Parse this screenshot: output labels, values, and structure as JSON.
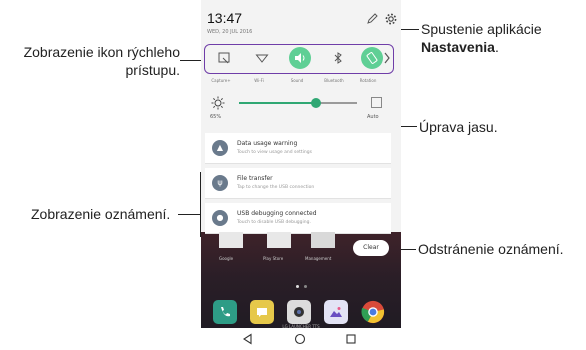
{
  "callouts": {
    "quick_access": "Zobrazenie ikon rýchleho prístupu.",
    "settings_prefix": "Spustenie aplikácie",
    "settings_bold": "Nastavenia",
    "settings_suffix": ".",
    "brightness": "Úprava jasu.",
    "notifications": "Zobrazenie oznámení.",
    "clear": "Odstránenie oznámení."
  },
  "status": {
    "time": "13:47",
    "date": "WED, 20 JUL 2016"
  },
  "quick_settings": [
    {
      "label": "Capture+",
      "icon": "capture-icon",
      "on": false
    },
    {
      "label": "Wi-Fi",
      "icon": "wifi-icon",
      "on": false
    },
    {
      "label": "Sound",
      "icon": "sound-icon",
      "on": true
    },
    {
      "label": "Bluetooth",
      "icon": "bluetooth-icon",
      "on": false
    },
    {
      "label": "Rotation",
      "icon": "rotation-icon",
      "on": true
    }
  ],
  "brightness": {
    "percent_label": "65%",
    "level": 0.65,
    "auto_label": "Auto"
  },
  "notifications": [
    {
      "title": "Data usage warning",
      "subtitle": "Touch to view usage and settings",
      "icon": "warning-icon",
      "glyph": "▲"
    },
    {
      "title": "File transfer",
      "subtitle": "Tap to change the USB connection",
      "icon": "usb-icon",
      "glyph": "ψ"
    },
    {
      "title": "USB debugging connected",
      "subtitle": "Touch to disable USB debugging.",
      "icon": "android-icon",
      "glyph": "●"
    }
  ],
  "home": {
    "peek_labels": [
      "Google",
      "Play Store",
      "Management"
    ],
    "clear_label": "Clear",
    "dock_label": "LG LAUNCHER TTS"
  },
  "colors": {
    "accent_green": "#5fcf95",
    "highlight_purple": "#6f3da8"
  }
}
